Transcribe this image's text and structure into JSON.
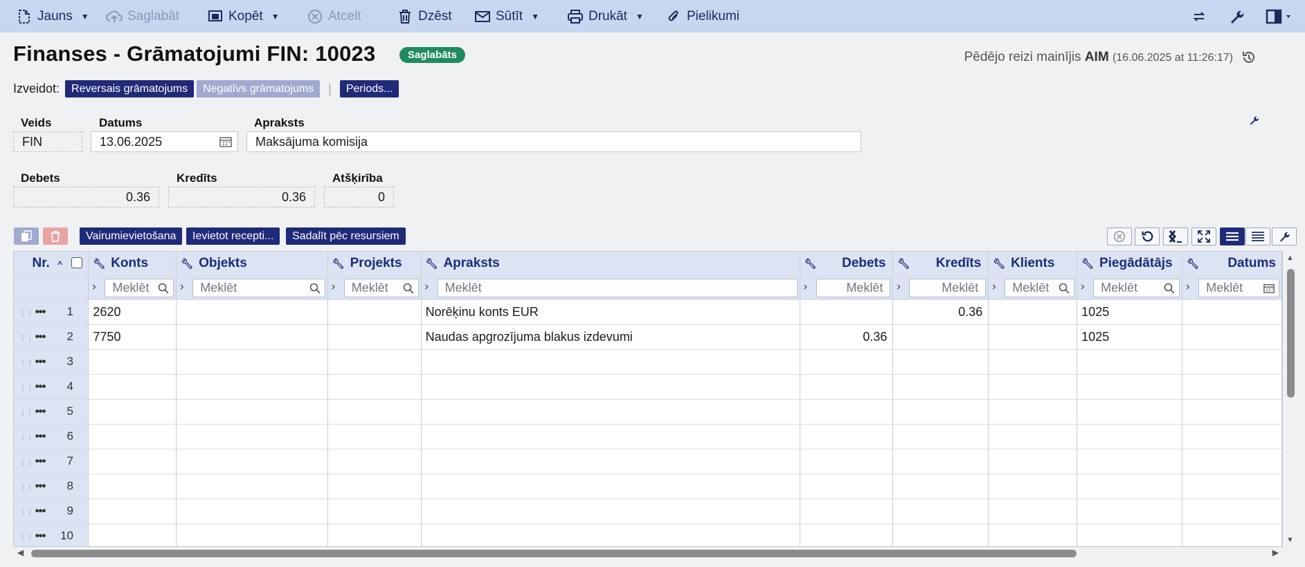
{
  "toolbar": {
    "new_label": "Jauns",
    "save_label": "Saglabāt",
    "copy_label": "Kopēt",
    "cancel_label": "Atcelt",
    "delete_label": "Dzēst",
    "send_label": "Sūtīt",
    "print_label": "Drukāt",
    "attachments_label": "Pielikumi"
  },
  "header": {
    "title": "Finanses - Grāmatojumi FIN: 10023",
    "status_badge": "Saglabāts",
    "modified_prefix": "Pēdējo reizi mainījis",
    "modified_user": "AIM",
    "modified_time": "(16.06.2025 at 11:26:17)"
  },
  "create": {
    "label": "Izveidot:",
    "buttons": [
      "Reversais grāmatojums",
      "Negatīvs grāmatojums",
      "Periods..."
    ]
  },
  "form": {
    "type_label": "Veids",
    "type_value": "FIN",
    "date_label": "Datums",
    "date_value": "13.06.2025",
    "desc_label": "Apraksts",
    "desc_value": "Maksājuma komisija",
    "debit_label": "Debets",
    "debit_value": "0.36",
    "credit_label": "Kredīts",
    "credit_value": "0.36",
    "diff_label": "Atšķirība",
    "diff_value": "0"
  },
  "grid_toolbar": {
    "buttons": [
      "Vairumievietošana",
      "Ievietot recepti...",
      "Sadalīt pēc resursiem"
    ]
  },
  "grid": {
    "columns": [
      "Nr.",
      "Konts",
      "Objekts",
      "Projekts",
      "Apraksts",
      "Debets",
      "Kredīts",
      "Klients",
      "Piegādātājs",
      "Datums"
    ],
    "search_placeholder": "Meklēt",
    "rows": [
      {
        "nr": "1",
        "konts": "2620",
        "objekts": "",
        "projekts": "",
        "apraksts": "Norēķinu konts EUR",
        "debets": "",
        "kredits": "0.36",
        "klients": "",
        "piegadatajs": "1025",
        "datums": ""
      },
      {
        "nr": "2",
        "konts": "7750",
        "objekts": "",
        "projekts": "",
        "apraksts": "Naudas apgrozījuma blakus izdevumi",
        "debets": "0.36",
        "kredits": "",
        "klients": "",
        "piegadatajs": "1025",
        "datums": ""
      },
      {
        "nr": "3",
        "konts": "",
        "objekts": "",
        "projekts": "",
        "apraksts": "",
        "debets": "",
        "kredits": "",
        "klients": "",
        "piegadatajs": "",
        "datums": ""
      },
      {
        "nr": "4",
        "konts": "",
        "objekts": "",
        "projekts": "",
        "apraksts": "",
        "debets": "",
        "kredits": "",
        "klients": "",
        "piegadatajs": "",
        "datums": ""
      },
      {
        "nr": "5",
        "konts": "",
        "objekts": "",
        "projekts": "",
        "apraksts": "",
        "debets": "",
        "kredits": "",
        "klients": "",
        "piegadatajs": "",
        "datums": ""
      },
      {
        "nr": "6",
        "konts": "",
        "objekts": "",
        "projekts": "",
        "apraksts": "",
        "debets": "",
        "kredits": "",
        "klients": "",
        "piegadatajs": "",
        "datums": ""
      },
      {
        "nr": "7",
        "konts": "",
        "objekts": "",
        "projekts": "",
        "apraksts": "",
        "debets": "",
        "kredits": "",
        "klients": "",
        "piegadatajs": "",
        "datums": ""
      },
      {
        "nr": "8",
        "konts": "",
        "objekts": "",
        "projekts": "",
        "apraksts": "",
        "debets": "",
        "kredits": "",
        "klients": "",
        "piegadatajs": "",
        "datums": ""
      },
      {
        "nr": "9",
        "konts": "",
        "objekts": "",
        "projekts": "",
        "apraksts": "",
        "debets": "",
        "kredits": "",
        "klients": "",
        "piegadatajs": "",
        "datums": ""
      },
      {
        "nr": "10",
        "konts": "",
        "objekts": "",
        "projekts": "",
        "apraksts": "",
        "debets": "",
        "kredits": "",
        "klients": "",
        "piegadatajs": "",
        "datums": ""
      }
    ]
  },
  "colors": {
    "toolbar_bg": "#c9d6f0",
    "navy": "#1f2a78",
    "badge_green": "#1f8a5b"
  }
}
